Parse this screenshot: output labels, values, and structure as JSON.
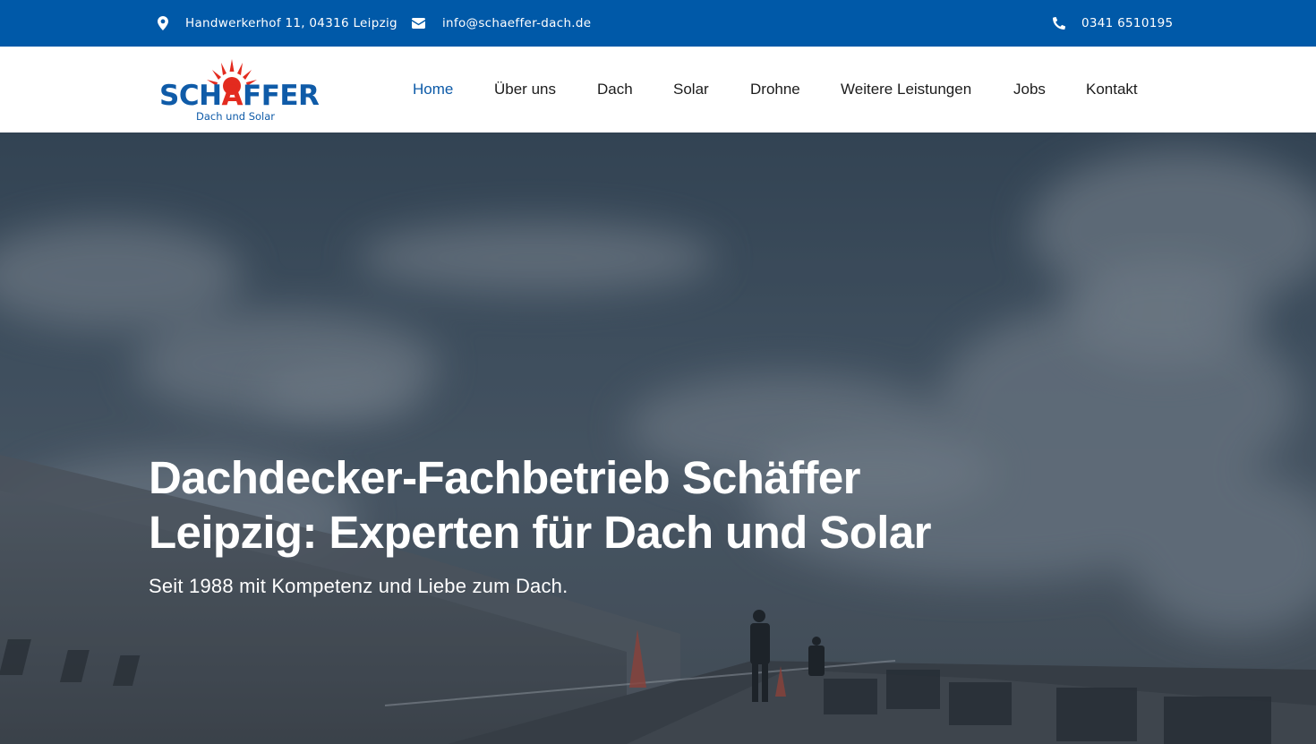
{
  "topbar": {
    "address": "Handwerkerhof 11, 04316 Leipzig",
    "address_icon": "location-pin-icon",
    "email": "info@schaeffer-dach.de",
    "email_icon": "envelope-icon",
    "phone": "0341 6510195",
    "phone_icon": "phone-icon",
    "background_color": "#0059a8"
  },
  "logo": {
    "text_before": "SCH",
    "text_accent": "A",
    "text_after": "FFER",
    "subtitle": "Dach und Solar",
    "brand_blue": "#0f5ba8",
    "brand_red": "#e32b1f"
  },
  "nav": {
    "items": [
      {
        "label": "Home",
        "active": true
      },
      {
        "label": "Über uns",
        "active": false
      },
      {
        "label": "Dach",
        "active": false
      },
      {
        "label": "Solar",
        "active": false
      },
      {
        "label": "Drohne",
        "active": false
      },
      {
        "label": "Weitere Leistungen",
        "active": false
      },
      {
        "label": "Jobs",
        "active": false
      },
      {
        "label": "Kontakt",
        "active": false
      }
    ],
    "active_color": "#0c5aa8"
  },
  "hero": {
    "headline": "Dachdecker-Fachbetrieb Schäffer Leipzig: Experten für Dach und Solar",
    "subline": "Seit 1988 mit Kompetenz und Liebe zum Dach."
  }
}
